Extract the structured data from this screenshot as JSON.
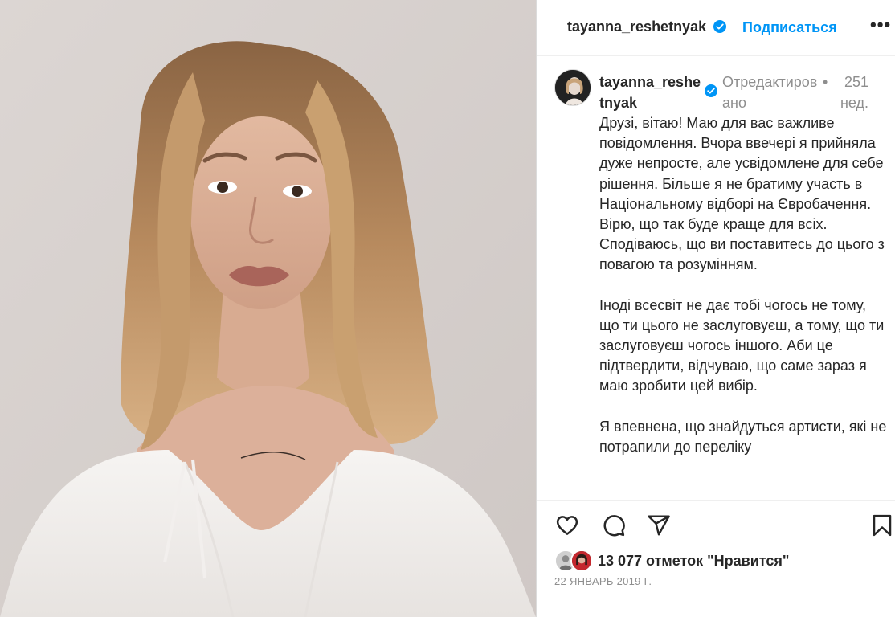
{
  "header": {
    "username": "tayanna_reshetnyak",
    "follow_label": "Подписаться",
    "more_label": "•••"
  },
  "caption": {
    "username": "tayanna_reshetnyak",
    "edited_label": "Отредактировано",
    "separator": "•",
    "age": "251 нед.",
    "paragraphs": [
      "Друзі, вітаю! Маю для вас важливе повідомлення. Вчора ввечері я прийняла дуже непросте, але усвідомлене для себе рішення. Більше я не братиму участь в Національному відборі на Євробачення. Вірю, що так буде краще для всіх. Сподіваюсь, що ви поставитесь до цього з повагою та розумінням.",
      "Іноді всесвіт не дає тобі чогось не тому, що ти цього не заслуговуєш, а тому, що ти заслуговуєш чогось іншого. Аби це підтвердити, відчуваю, що саме зараз я маю зробити цей вибір.",
      "Я впевнена, що знайдуться артисти, які не потрапили до переліку"
    ]
  },
  "actions": {
    "like_icon": "heart-icon",
    "comment_icon": "comment-icon",
    "share_icon": "paper-plane-icon",
    "save_icon": "bookmark-icon"
  },
  "likes": {
    "text": "13 077 отметок \"Нравится\""
  },
  "date": "22 ЯНВАРЬ 2019 Г.",
  "colors": {
    "accent": "#0095f6",
    "text": "#262626",
    "muted": "#8e8e8e",
    "border": "#dbdbdb"
  }
}
